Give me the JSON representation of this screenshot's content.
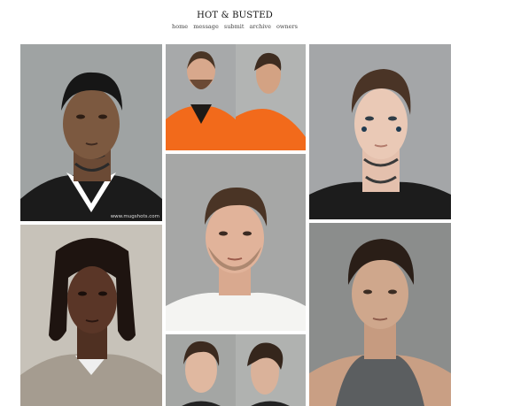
{
  "site": {
    "title": "HOT & BUSTED"
  },
  "nav": [
    "home",
    "message",
    "submit",
    "archive",
    "owners"
  ],
  "watermark": "www.mugshots.com",
  "colors": {
    "orange_jumpsuit": "#f26a1b",
    "wall_gray": "#a8abae",
    "bg": "#ffffff"
  },
  "posts": [
    {
      "desc": "young man with neck tattoos, black shirt"
    },
    {
      "desc": "man in orange jumpsuit, front and profile"
    },
    {
      "desc": "man with face and neck tattoos, black shirt"
    },
    {
      "desc": "man in white collared shirt"
    },
    {
      "desc": "man with dreadlocks, gray shirt"
    },
    {
      "desc": "man with dark hair, gray tank top"
    },
    {
      "desc": "young man, front and profile"
    }
  ]
}
